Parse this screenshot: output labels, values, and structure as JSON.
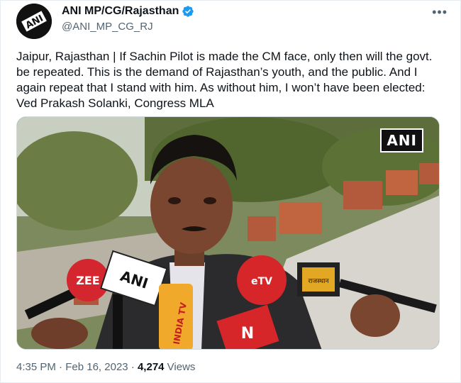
{
  "account": {
    "name": "ANI MP/CG/Rajasthan",
    "handle": "@ANI_MP_CG_RJ",
    "avatar_text": "ANI"
  },
  "tweet": {
    "text": "Jaipur, Rajasthan | If Sachin Pilot is made the CM face, only then will the govt. be repeated. This is the demand of Rajasthan’s youth, and the public. And I again repeat that I stand with him. As without him, I won’t have been elected: Ved Prakash Solanki, Congress MLA"
  },
  "media": {
    "watermark": "ANI",
    "mic_labels": [
      "ZEE",
      "ANI",
      "INDIA TV",
      "N",
      "eTV",
      "राजस्थान"
    ]
  },
  "meta": {
    "time": "4:35 PM",
    "separator1": " · ",
    "date": "Feb 16, 2023",
    "separator2": " · ",
    "views_count": "4,274",
    "views_label": " Views"
  },
  "icons": {
    "verified": "verified-badge-icon",
    "more": "more-options-icon"
  },
  "colors": {
    "verified_blue": "#1d9bf0",
    "secondary_text": "#536471"
  }
}
